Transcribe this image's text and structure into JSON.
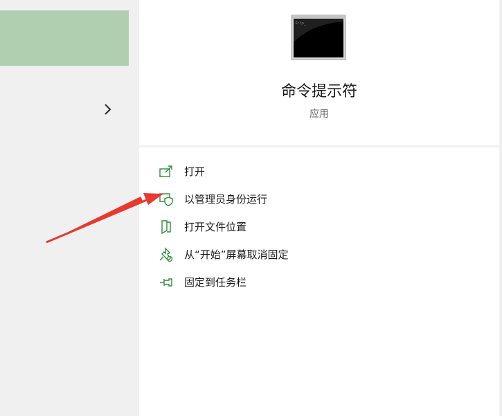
{
  "app": {
    "title": "命令提示符",
    "type": "应用"
  },
  "actions": [
    {
      "label": "打开",
      "icon": "open-icon"
    },
    {
      "label": "以管理员身份运行",
      "icon": "admin-shield-icon"
    },
    {
      "label": "打开文件位置",
      "icon": "file-location-icon"
    },
    {
      "label": "从“开始”屏幕取消固定",
      "icon": "unpin-icon"
    },
    {
      "label": "固定到任务栏",
      "icon": "pin-taskbar-icon"
    }
  ],
  "colors": {
    "selected_bg": "#b0cfb0",
    "icon_green": "#2e8b3a",
    "arrow_red": "#e8392f"
  }
}
